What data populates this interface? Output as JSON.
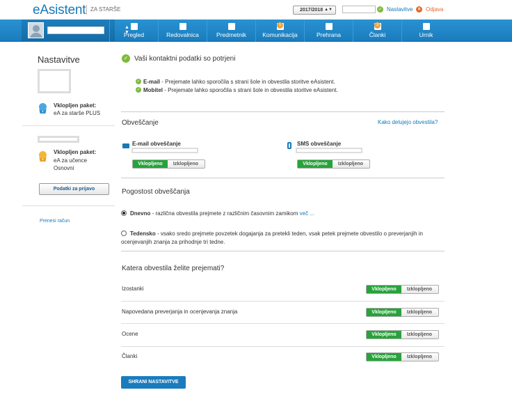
{
  "header": {
    "logo": "eAsistent",
    "logo_sub": "ZA STARŠE",
    "school_year": "2017/2018",
    "settings_link": "Nastavitve",
    "logout": "Odjava"
  },
  "nav": {
    "items": [
      {
        "label": "Pregled"
      },
      {
        "label": "Redovalnica"
      },
      {
        "label": "Predmetnik"
      },
      {
        "label": "Komunikacija",
        "badge": "1"
      },
      {
        "label": "Prehrana"
      },
      {
        "label": "Članki",
        "badge": "3"
      },
      {
        "label": "Urnik"
      }
    ]
  },
  "sidebar": {
    "title": "Nastavitve",
    "package1": {
      "title": "Vklopljen paket:",
      "line1": "eA za starše PLUS"
    },
    "package2": {
      "title": "Vklopljen paket:",
      "line1": "eA za učence",
      "line2": "Osnovni"
    },
    "login_button": "Podatki za prijavo",
    "transfer_link": "Prenesi račun"
  },
  "contact": {
    "confirmed": "Vaši kontaktni podatki so potrjeni",
    "email_label": "E-mail",
    "email_text": " - Prejemate lahko sporočila s strani šole in obvestila storitve eAsistent.",
    "mobile_label": "Mobitel",
    "mobile_text": " - Prejemate lahko sporočila s strani šole in obvestila storitve eAsistent."
  },
  "notifications": {
    "title": "Obveščanje",
    "help_link": "Kako delujejo obvestila?",
    "email_title": "E-mail obveščanje",
    "sms_title": "SMS obveščanje",
    "on": "Vklopljeno",
    "off": "Izklopljeno"
  },
  "frequency": {
    "title": "Pogostost obveščanja",
    "daily_label": "Dnevno",
    "daily_text": " - različna obvestila prejmete z različnim časovnim zamikom ",
    "daily_more": "več ...",
    "weekly_label": "Tedensko",
    "weekly_text_line1": " - vsako sredo prejmete povzetek dogajanja za pretekli teden, vsak petek prejmete obvestilo o preverjanjih in",
    "weekly_text_line2": "ocenjevanjih znanja za prihodnje tri tedne."
  },
  "which": {
    "title": "Katera obvestila želite prejemati?",
    "rows": [
      {
        "label": "Izostanki"
      },
      {
        "label": "Napovedana preverjanja in ocenjevanja znanja"
      },
      {
        "label": "Ocene"
      },
      {
        "label": "Članki"
      }
    ],
    "on": "Vklopljeno",
    "off": "Izklopljeno"
  },
  "save_button": "SHRANI NASTAVITVE",
  "colors": {
    "brand": "#1779b8",
    "on": "#27a33a",
    "check": "#7dbb3d",
    "logout": "#e26a2c"
  }
}
